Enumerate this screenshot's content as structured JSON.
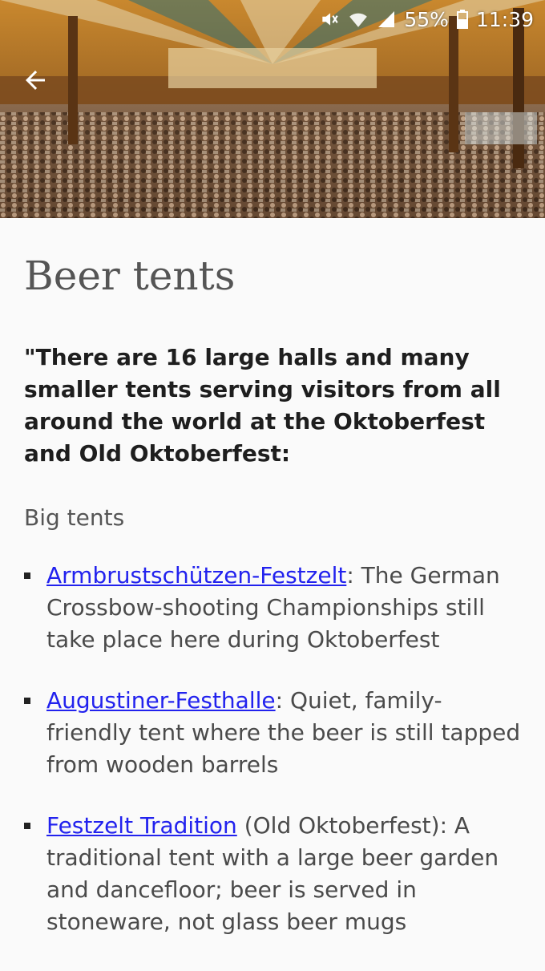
{
  "status_bar": {
    "battery": "55%",
    "time": "11:39",
    "icons": [
      "mute-icon",
      "wifi-icon",
      "signal-icon",
      "battery-icon"
    ]
  },
  "header": {
    "back_icon": "arrow-back-icon",
    "hero_image": "beer-hall-crowd-photo"
  },
  "article": {
    "title": "Beer tents",
    "intro": "\"There are 16 large halls and many smaller tents serving visitors from all around the world at the Oktoberfest and Old Oktoberfest:",
    "section_label": "Big tents",
    "items": [
      {
        "link": "Armbrustschützen-Festzelt",
        "text": ": The German Crossbow-shooting Championships still take place here during Oktoberfest"
      },
      {
        "link": "Augustiner-Festhalle",
        "text": ": Quiet, family-friendly tent where the beer is still tapped from wooden barrels"
      },
      {
        "link": "Festzelt Tradition",
        "text": " (Old Oktoberfest): A traditional tent with a large beer garden and dancefloor; beer is served in stoneware, not glass beer mugs"
      }
    ]
  },
  "colors": {
    "link": "#2222ee",
    "title": "#555555",
    "body": "#4a4a4a",
    "background": "#fafafa"
  }
}
